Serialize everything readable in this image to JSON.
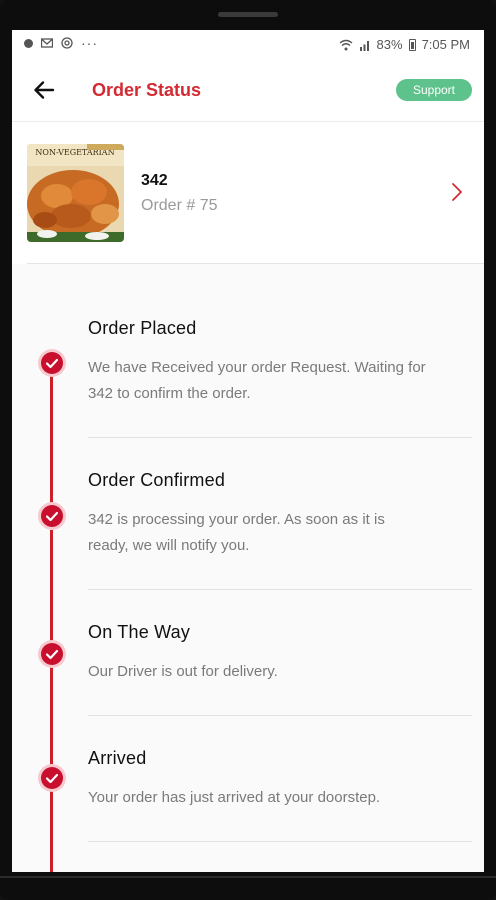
{
  "status_bar": {
    "battery": "83%",
    "time": "7:05 PM"
  },
  "header": {
    "title": "Order Status",
    "support_label": "Support"
  },
  "order": {
    "restaurant_name": "342",
    "order_number": "Order # 75",
    "thumbnail_text": "NON-VEGETARIAN"
  },
  "steps": [
    {
      "title": "Order Placed",
      "description": "We have Received your order Request. Waiting for 342 to confirm the order."
    },
    {
      "title": "Order Confirmed",
      "description": "342 is processing your order. As soon as it is ready, we will notify you."
    },
    {
      "title": "On The Way",
      "description": "Our Driver is out for delivery."
    },
    {
      "title": "Arrived",
      "description": "Your order has just arrived at your doorstep."
    }
  ],
  "colors": {
    "accent": "#d42a31",
    "support": "#5ec28c",
    "timeline": "#cc1f28"
  }
}
